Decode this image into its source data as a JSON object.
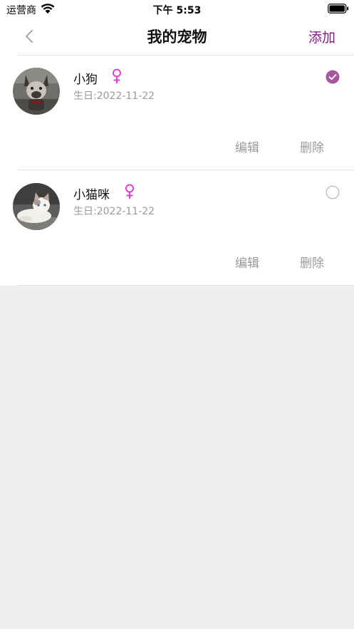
{
  "status_bar": {
    "carrier": "运营商",
    "time": "下午 5:53"
  },
  "nav": {
    "title": "我的宠物",
    "add_label": "添加"
  },
  "pets": [
    {
      "name": "小狗",
      "gender_symbol": "♀",
      "birthday": "生日:2022-11-22",
      "selected": true,
      "edit_label": "编辑",
      "delete_label": "删除"
    },
    {
      "name": "小猫咪",
      "gender_symbol": "♀",
      "birthday": "生日:2022-11-22",
      "selected": false,
      "edit_label": "编辑",
      "delete_label": "删除"
    }
  ],
  "colors": {
    "accent": "#8a1a8c",
    "selected_radio": "#a5579b",
    "gender": "#e040d0",
    "muted_text": "#9a9a9a",
    "background": "#efefef"
  }
}
